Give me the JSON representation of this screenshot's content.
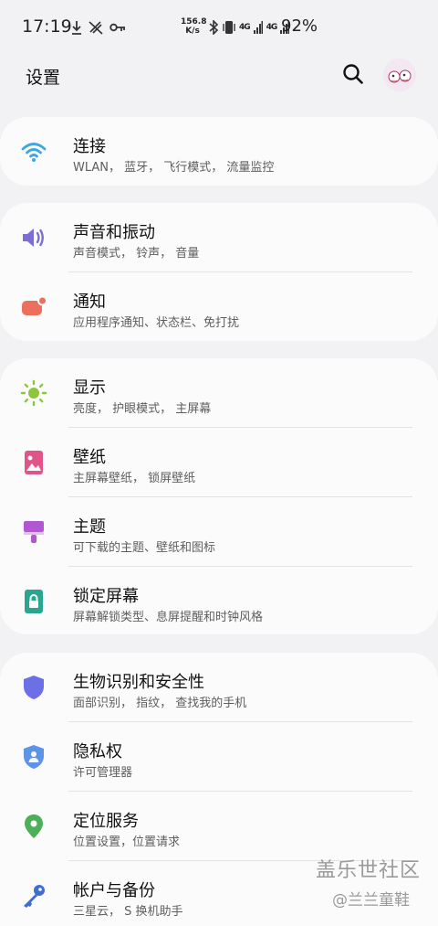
{
  "status_bar": {
    "time": "17:19",
    "net_speed_value": "156.8",
    "net_speed_unit": "K/s",
    "signal1": "4G",
    "signal2": "4G",
    "battery": "92%"
  },
  "header": {
    "title": "设置",
    "search_icon": "search-icon"
  },
  "sections": [
    {
      "items": [
        {
          "title": "连接",
          "subtitle": "WLAN， 蓝牙， 飞行模式， 流量监控",
          "icon": "wifi-icon",
          "color": "#3ea6e0"
        }
      ]
    },
    {
      "items": [
        {
          "title": "声音和振动",
          "subtitle": "声音模式， 铃声， 音量",
          "icon": "volume-icon",
          "color": "#7b6fd6"
        },
        {
          "title": "通知",
          "subtitle": "应用程序通知、状态栏、免打扰",
          "icon": "notification-icon",
          "color": "#ec6f5e"
        }
      ]
    },
    {
      "items": [
        {
          "title": "显示",
          "subtitle": "亮度， 护眼模式， 主屏幕",
          "icon": "brightness-icon",
          "color": "#8cc63f"
        },
        {
          "title": "壁纸",
          "subtitle": "主屏幕壁纸， 锁屏壁纸",
          "icon": "wallpaper-icon",
          "color": "#e0548a"
        },
        {
          "title": "主题",
          "subtitle": "可下载的主题、壁纸和图标",
          "icon": "theme-brush-icon",
          "color": "#b257d1"
        },
        {
          "title": "锁定屏幕",
          "subtitle": "屏幕解锁类型、息屏提醒和时钟风格",
          "icon": "lock-screen-icon",
          "color": "#2aa590"
        }
      ]
    },
    {
      "items": [
        {
          "title": "生物识别和安全性",
          "subtitle": "面部识别， 指纹， 查找我的手机",
          "icon": "shield-icon",
          "color": "#6d6fe6"
        },
        {
          "title": "隐私权",
          "subtitle": "许可管理器",
          "icon": "privacy-shield-icon",
          "color": "#5d93e8"
        },
        {
          "title": "定位服务",
          "subtitle": "位置设置，位置请求",
          "icon": "location-pin-icon",
          "color": "#4cb05a"
        },
        {
          "title": "帐户与备份",
          "subtitle": "三星云， S 换机助手",
          "icon": "key-icon",
          "color": "#3e6fd0"
        }
      ]
    }
  ],
  "watermark": {
    "title": "盖乐世社区",
    "handle": "@兰兰童鞋"
  }
}
